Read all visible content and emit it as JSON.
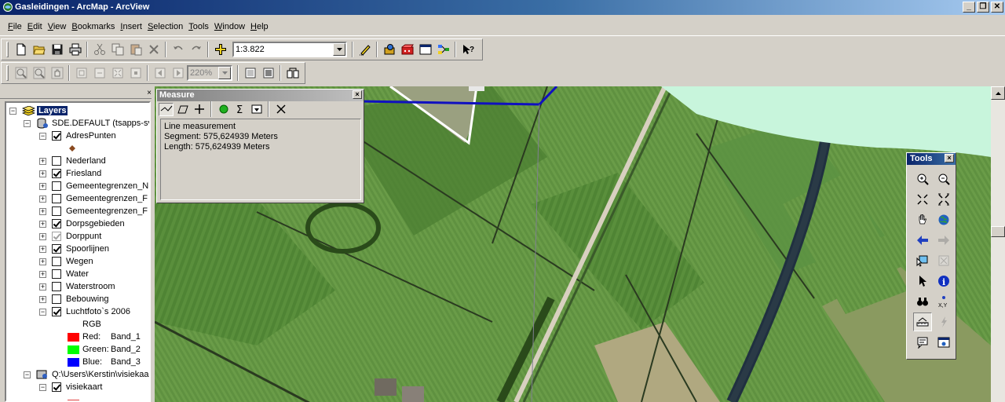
{
  "window": {
    "title": "Gasleidingen - ArcMap - ArcView",
    "controls": {
      "minimize": "_",
      "restore": "❐",
      "close": "✕"
    }
  },
  "menu": [
    {
      "label": "File",
      "accel": "F",
      "rest": "ile"
    },
    {
      "label": "Edit",
      "accel": "E",
      "rest": "dit"
    },
    {
      "label": "View",
      "accel": "V",
      "rest": "iew"
    },
    {
      "label": "Bookmarks",
      "accel": "B",
      "rest": "ookmarks"
    },
    {
      "label": "Insert",
      "accel": "I",
      "rest": "nsert"
    },
    {
      "label": "Selection",
      "accel": "S",
      "rest": "election"
    },
    {
      "label": "Tools",
      "accel": "T",
      "rest": "ools"
    },
    {
      "label": "Window",
      "accel": "W",
      "rest": "indow"
    },
    {
      "label": "Help",
      "accel": "H",
      "rest": "elp"
    }
  ],
  "standard_toolbar": {
    "scale": "1:3.822",
    "icons": [
      "new-document-icon",
      "open-folder-icon",
      "save-icon",
      "print-icon",
      "cut-icon",
      "copy-icon",
      "paste-icon",
      "delete-icon",
      "undo-icon",
      "redo-icon",
      "add-data-icon",
      "editor-toolbar-icon",
      "arctoolbox-icon",
      "arccatalog-icon",
      "command-line-icon",
      "model-builder-icon",
      "whats-this-help-icon"
    ]
  },
  "layout_toolbar": {
    "zoom_percent": "220%"
  },
  "toc": {
    "close": "×",
    "root": "Layers",
    "group1": "SDE.DEFAULT (tsapps-sv",
    "layers": [
      {
        "name": "AdresPunten",
        "checked": true
      },
      {
        "name": "Nederland",
        "checked": false
      },
      {
        "name": "Friesland",
        "checked": true
      },
      {
        "name": "Gemeentegrenzen_N",
        "checked": false
      },
      {
        "name": "Gemeentegrenzen_F",
        "checked": false
      },
      {
        "name": "Gemeentegrenzen_F",
        "checked": false
      },
      {
        "name": "Dorpsgebieden",
        "checked": true
      },
      {
        "name": "Dorppunt",
        "checked": true,
        "gray": true
      },
      {
        "name": "Spoorlijnen",
        "checked": true
      },
      {
        "name": "Wegen",
        "checked": false
      },
      {
        "name": "Water",
        "checked": false
      },
      {
        "name": "Waterstroom",
        "checked": false
      },
      {
        "name": "Bebouwing",
        "checked": false
      },
      {
        "name": "Luchtfoto`s 2006",
        "checked": true
      }
    ],
    "rgb_label": "RGB",
    "bands": [
      {
        "channel": "Red:",
        "band": "Band_1",
        "color": "#ff0000"
      },
      {
        "channel": "Green:",
        "band": "Band_2",
        "color": "#00ff00"
      },
      {
        "channel": "Blue:",
        "band": "Band_3",
        "color": "#0000ff"
      }
    ],
    "group2": "Q:\\Users\\Kerstin\\visiekaa",
    "visiekaart": {
      "name": "visiekaart",
      "checked": true
    }
  },
  "measure": {
    "title": "Measure",
    "close": "×",
    "line1": "Line measurement",
    "line2": "Segment: 575,624939 Meters",
    "line3": "Length: 575,624939 Meters"
  },
  "tools_window": {
    "title": "Tools",
    "close": "×",
    "icons": [
      "zoom-in-icon",
      "zoom-out-icon",
      "fixed-zoom-in-icon",
      "fixed-zoom-out-icon",
      "pan-hand-icon",
      "full-extent-globe-icon",
      "back-extent-icon",
      "forward-extent-icon",
      "select-features-icon",
      "clear-selection-icon",
      "select-elements-icon",
      "identify-icon",
      "find-binoculars-icon",
      "go-to-xy-icon",
      "measure-icon",
      "hyperlink-icon",
      "html-popup-icon",
      "overview-window-icon"
    ]
  },
  "colors": {
    "title_bar": "#0a246a",
    "selection": "#0a246a",
    "water": "#c8f5dc",
    "pipeline": "#1010c0"
  }
}
